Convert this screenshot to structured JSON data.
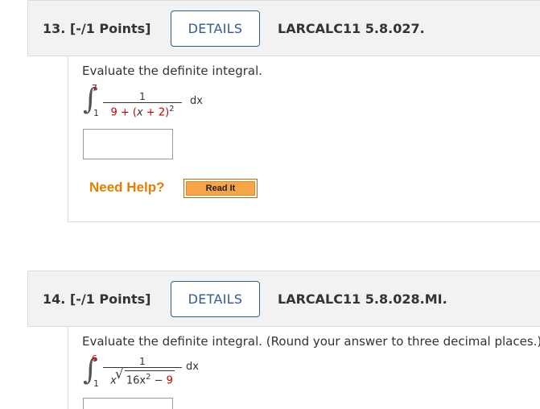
{
  "questions": [
    {
      "number_label": "13. [-/1 Points]",
      "details_label": "DETAILS",
      "code": "LARCALC11 5.8.027.",
      "prompt": "Evaluate the definite integral.",
      "integral": {
        "upper": "7",
        "lower": "1",
        "numerator": "1",
        "denominator_a": "9 + (",
        "denominator_b": "x",
        "denominator_c": " + 2)",
        "denominator_exp": "2",
        "differential": "dx"
      },
      "need_help": "Need Help?",
      "read_it": "Read It"
    },
    {
      "number_label": "14. [-/1 Points]",
      "details_label": "DETAILS",
      "code": "LARCALC11 5.8.028.MI.",
      "prompt": "Evaluate the definite integral. (Round your answer to three decimal places.)",
      "integral": {
        "upper": "6",
        "lower": "1",
        "numerator": "1",
        "denominator_x": "x",
        "sqrt_a": "16x",
        "sqrt_exp": "2",
        "sqrt_b": " − ",
        "sqrt_c": "9",
        "differential": "dx"
      }
    }
  ],
  "colors": {
    "accent": "#2f5e8c",
    "limit_red": "#c00000",
    "help_orange": "#e67e00",
    "button_orange": "#f7a347"
  }
}
